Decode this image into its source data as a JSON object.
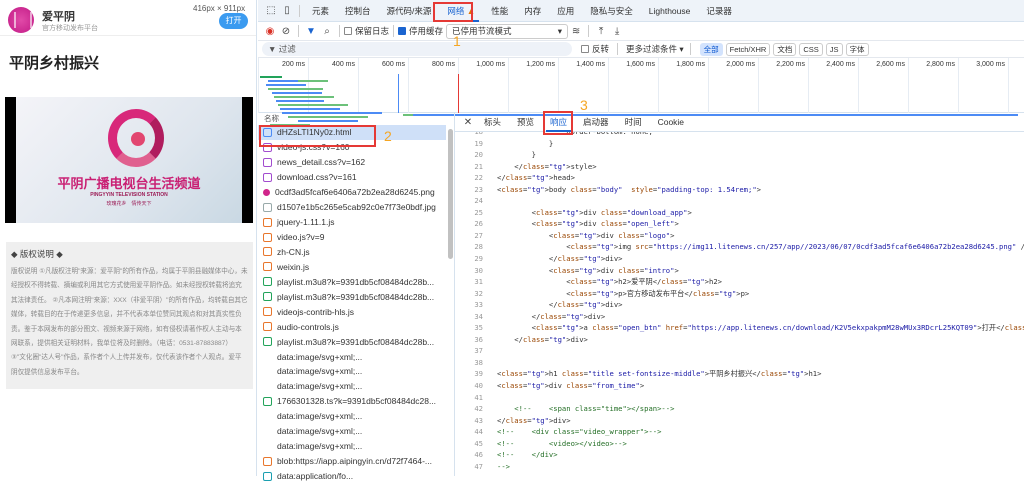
{
  "page": {
    "app_name": "爱平阴",
    "app_subtitle": "官方移动发布平台",
    "open_button": "打开",
    "viewport_size": "416px × 911px",
    "title": "平阴乡村振兴",
    "video": {
      "channel_name": "平阴广播电视台生活频道",
      "station_en": "PINGYYIN TELEVISION STATION",
      "slogan": "玫瑰花乡　情传天下"
    },
    "copyright": {
      "heading": "◆ 版权说明 ◆",
      "body": "版权说明 ①凡版权注明\"来源：爱平阴\"的所有作品，均属于平阴县融媒体中心，未经授权不得转载、摘编或利用其它方式使用爱平阴作品。如未经授权转载将追究其法律责任。 ②凡本网注明\"来源：XXX（非爱平阴）\"的所有作品，均转载自其它媒体，转载目的在于传递更多信息，并不代表本单位赞同其观点和对其真实性负责。鉴于本网发布的部分图文、视频来源于网络，如有侵权请著作权人主动与本网联系，提供相关证明材料，我单位将及时删除。（电话：0531-87883887） ③\"文化圈\"达人号\"作品，系作者个人上传并发布，仅代表该作者个人观点。爱平阴仅提供信息发布平台。"
    }
  },
  "devtools": {
    "tabs": [
      "元素",
      "控制台",
      "源代码/来源",
      "网络",
      "性能",
      "内存",
      "应用",
      "隐私与安全",
      "Lighthouse",
      "记录器"
    ],
    "active_tab": "网络",
    "toolbar": {
      "preserve_log": "保留日志",
      "disable_cache": "停用缓存",
      "disable_cache_checked": true,
      "preserve_log_checked": false,
      "throttling": "已停用节流模式"
    },
    "filter": {
      "placeholder": "过滤",
      "invert": "反转",
      "more_filters": "更多过滤条件 ▾",
      "types": [
        "全部",
        "Fetch/XHR",
        "文档",
        "CSS",
        "JS",
        "字体"
      ],
      "active_type": "全部"
    },
    "timeline_ticks": [
      "200 ms",
      "400 ms",
      "600 ms",
      "800 ms",
      "1,000 ms",
      "1,200 ms",
      "1,400 ms",
      "1,600 ms",
      "1,800 ms",
      "2,000 ms",
      "2,200 ms",
      "2,400 ms",
      "2,600 ms",
      "2,800 ms",
      "3,000 ms",
      "3,200 ms"
    ],
    "list_header": "名称",
    "requests": [
      {
        "name": "dHZsLTI1Ny0z.html",
        "type": "doc"
      },
      {
        "name": "video-js.css?v=160",
        "type": "css"
      },
      {
        "name": "news_detail.css?v=162",
        "type": "css"
      },
      {
        "name": "download.css?v=161",
        "type": "css"
      },
      {
        "name": "0cdf3ad5fcaf6e6406a72b2ea28d6245.png",
        "type": "png"
      },
      {
        "name": "d1507e1b5c265e5cab92c0e7f73e0bdf.jpg",
        "type": "img"
      },
      {
        "name": "jquery-1.11.1.js",
        "type": "js"
      },
      {
        "name": "video.js?v=9",
        "type": "js"
      },
      {
        "name": "zh-CN.js",
        "type": "js"
      },
      {
        "name": "weixin.js",
        "type": "js"
      },
      {
        "name": "playlist.m3u8?k=9391db5cf08484dc28b...",
        "type": "media"
      },
      {
        "name": "playlist.m3u8?k=9391db5cf08484dc28b...",
        "type": "media"
      },
      {
        "name": "videojs-contrib-hls.js",
        "type": "js"
      },
      {
        "name": "audio-controls.js",
        "type": "js"
      },
      {
        "name": "playlist.m3u8?k=9391db5cf08484dc28b...",
        "type": "media"
      },
      {
        "name": "data:image/svg+xml;...",
        "type": "svg"
      },
      {
        "name": "data:image/svg+xml;...",
        "type": "svg"
      },
      {
        "name": "data:image/svg+xml;...",
        "type": "svg"
      },
      {
        "name": "1766301328.ts?k=9391db5cf08484dc28...",
        "type": "media"
      },
      {
        "name": "data:image/svg+xml;...",
        "type": "svg"
      },
      {
        "name": "data:image/svg+xml;...",
        "type": "svg"
      },
      {
        "name": "data:image/svg+xml;...",
        "type": "svg"
      },
      {
        "name": "blob:https://iapp.aipingyin.cn/d72f7464-...",
        "type": "js"
      },
      {
        "name": "data:application/fo...",
        "type": "font"
      }
    ],
    "detail_tabs": [
      "标头",
      "预览",
      "响应",
      "启动器",
      "时间",
      "Cookie"
    ],
    "active_detail_tab": "响应",
    "code_start_line": 18,
    "code_lines": [
      "                border-bottom: none;",
      "            }",
      "        }",
      "    </style>",
      "</head>",
      "<body class=\"body\"  style=\"padding-top: 1.54rem;\">",
      "",
      "        <div class=\"download_app\">",
      "        <div class=\"open_left\">",
      "            <div class=\"logo\">",
      "                <img src=\"https://img11.litenews.cn/257/app//2023/06/07/0cdf3ad5fcaf6e6406a72b2ea28d6245.png\" />",
      "            </div>",
      "            <div class=\"intro\">",
      "                <h2>爱平阴</h2>",
      "                <p>官方移动发布平台</p>",
      "            </div>",
      "        </div>",
      "        <a class=\"open_btn\" href=\"https://app.litenews.cn/download/K2V5ekxpakpmM28wMUx3RDcrL25KQT09\">打开</a>",
      "    </div>",
      "",
      "",
      "<h1 class=\"title set-fontsize-middle\">平阴乡村振兴</h1>",
      "<div class=\"from_time\">",
      "",
      "    <!--    <span class=\"time\"></span>-->",
      "</div>",
      "<!--    <div class=\"video_wrapper\">-->",
      "<!--        <video></video>-->",
      "<!--    </div>",
      "-->"
    ]
  },
  "annotations": [
    "1",
    "2",
    "3"
  ],
  "colors": {
    "accent": "#1a64d0",
    "annotation_box": "#e53935",
    "annotation_number": "#f5a623"
  }
}
